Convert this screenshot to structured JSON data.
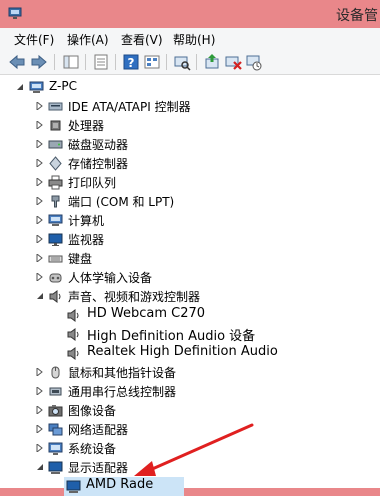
{
  "window": {
    "title": "设备管"
  },
  "menu": [
    {
      "label": "文件(F)"
    },
    {
      "label": "操作(A)"
    },
    {
      "label": "查看(V)"
    },
    {
      "label": "帮助(H)"
    }
  ],
  "toolbar": {
    "icons": [
      "back-arrow-icon",
      "forward-arrow-icon",
      "console-tree-icon",
      "properties-icon",
      "help-icon",
      "view-icon",
      "scan-hardware-icon",
      "update-driver-icon",
      "uninstall-icon",
      "enable-device-icon"
    ]
  },
  "tree": {
    "root": "Z-PC",
    "items": [
      {
        "label": "IDE ATA/ATAPI 控制器",
        "expanded": false
      },
      {
        "label": "处理器",
        "expanded": false
      },
      {
        "label": "磁盘驱动器",
        "expanded": false
      },
      {
        "label": "存储控制器",
        "expanded": false
      },
      {
        "label": "打印队列",
        "expanded": false
      },
      {
        "label": "端口 (COM 和 LPT)",
        "expanded": false
      },
      {
        "label": "计算机",
        "expanded": false
      },
      {
        "label": "监视器",
        "expanded": false
      },
      {
        "label": "键盘",
        "expanded": false
      },
      {
        "label": "人体学输入设备",
        "expanded": false
      },
      {
        "label": "声音、视频和游戏控制器",
        "expanded": true
      },
      {
        "label": "鼠标和其他指针设备",
        "expanded": false
      },
      {
        "label": "通用串行总线控制器",
        "expanded": false
      },
      {
        "label": "图像设备",
        "expanded": false
      },
      {
        "label": "网络适配器",
        "expanded": false
      },
      {
        "label": "系统设备",
        "expanded": false
      },
      {
        "label": "显示适配器",
        "expanded": true
      }
    ],
    "audio_children": [
      {
        "label": "HD Webcam C270"
      },
      {
        "label": "High Definition Audio 设备"
      },
      {
        "label": "Realtek High Definition Audio"
      }
    ],
    "display_children": [
      {
        "label": "AMD Rade"
      }
    ]
  },
  "colors": {
    "title_bar": "#e9878a",
    "annotation_arrow": "#e02020",
    "selection": "#cce4f7"
  }
}
